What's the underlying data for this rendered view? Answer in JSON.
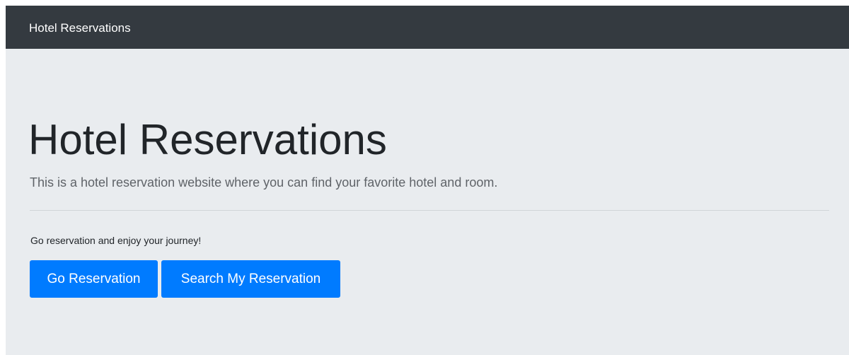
{
  "navbar": {
    "brand": "Hotel Reservations"
  },
  "jumbotron": {
    "title": "Hotel Reservations",
    "lead": "This is a hotel reservation website where you can find your favorite hotel and room.",
    "note": "Go reservation and enjoy your journey!",
    "buttons": {
      "go_reservation": "Go Reservation",
      "search_reservation": "Search My Reservation"
    }
  },
  "colors": {
    "navbar_bg": "#343a40",
    "page_bg": "#e9ecef",
    "primary": "#007bff"
  }
}
